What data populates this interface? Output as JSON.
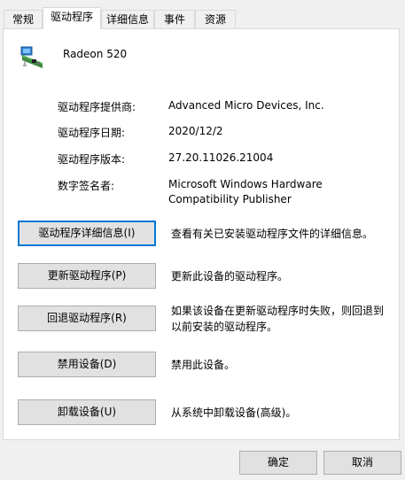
{
  "tabs": [
    {
      "label": "常规"
    },
    {
      "label": "驱动程序"
    },
    {
      "label": "详细信息"
    },
    {
      "label": "事件"
    },
    {
      "label": "资源"
    }
  ],
  "device": {
    "name": "Radeon 520",
    "icon": "display-adapter-icon"
  },
  "properties": {
    "provider": {
      "label": "驱动程序提供商:",
      "value": "Advanced Micro Devices, Inc."
    },
    "date": {
      "label": "驱动程序日期:",
      "value": "2020/12/2"
    },
    "version": {
      "label": "驱动程序版本:",
      "value": "27.20.11026.21004"
    },
    "signer": {
      "label": "数字签名者:",
      "value_line1": "Microsoft Windows Hardware",
      "value_line2": "Compatibility Publisher"
    }
  },
  "actions": {
    "details": {
      "label": "驱动程序详细信息(I)",
      "desc": "查看有关已安装驱动程序文件的详细信息。"
    },
    "update": {
      "label": "更新驱动程序(P)",
      "desc": "更新此设备的驱动程序。"
    },
    "rollback": {
      "label": "回退驱动程序(R)",
      "desc_line1": "如果该设备在更新驱动程序时失败，则回退到",
      "desc_line2": "以前安装的驱动程序。"
    },
    "disable": {
      "label": "禁用设备(D)",
      "desc": "禁用此设备。"
    },
    "uninstall": {
      "label": "卸载设备(U)",
      "desc": "从系统中卸载设备(高级)。"
    }
  },
  "dialog": {
    "ok": "确定",
    "cancel": "取消"
  },
  "colors": {
    "focus_border": "#0078d7",
    "button_face": "#e1e1e1",
    "window_bg": "#f0f0f0"
  }
}
